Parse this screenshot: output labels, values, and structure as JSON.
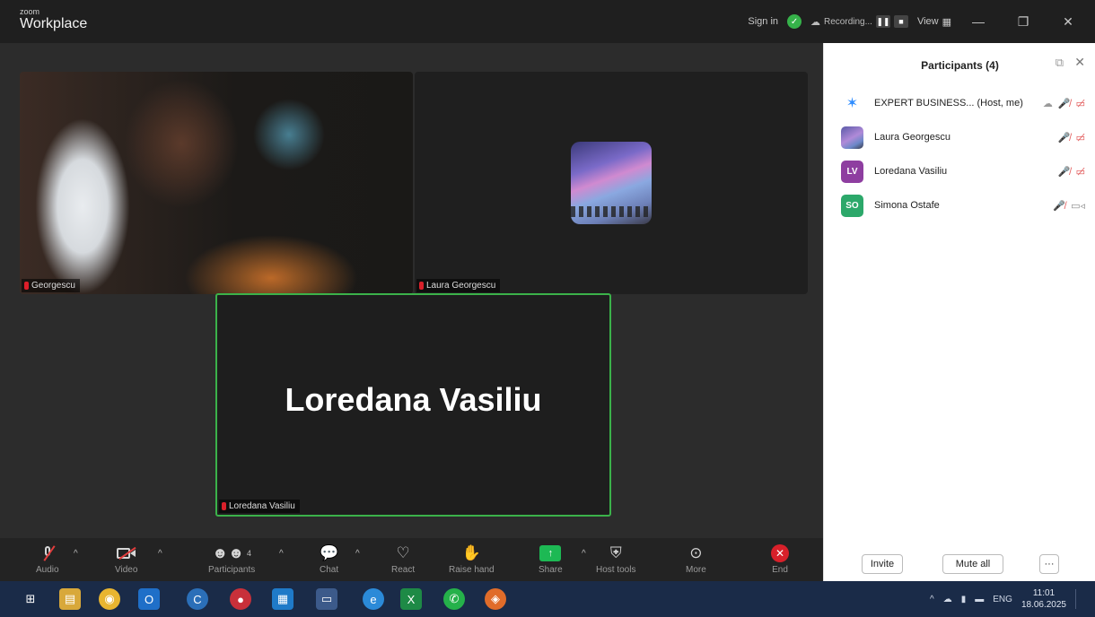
{
  "titlebar": {
    "brand_small": "zoom",
    "brand_big": "Workplace",
    "sign_in": "Sign in",
    "recording": "Recording...",
    "view": "View",
    "minimize": "—",
    "restore": "❐",
    "close": "✕"
  },
  "tiles": {
    "a_name": "Georgescu",
    "b_name": "Laura Georgescu",
    "c_name": "Loredana Vasiliu",
    "c_big": "Loredana Vasiliu"
  },
  "toolbar": {
    "audio": "Audio",
    "video": "Video",
    "participants": "Participants",
    "participants_count": "4",
    "chat": "Chat",
    "react": "React",
    "raise_hand": "Raise hand",
    "share": "Share",
    "host_tools": "Host tools",
    "more": "More",
    "end": "End"
  },
  "panel": {
    "title": "Participants (4)",
    "participants": [
      {
        "name": "EXPERT BUSINESS... (Host, me)",
        "initials": "",
        "cam_on": false
      },
      {
        "name": "Laura Georgescu",
        "initials": "",
        "cam_on": false
      },
      {
        "name": "Loredana Vasiliu",
        "initials": "LV",
        "cam_on": false
      },
      {
        "name": "Simona Ostafe",
        "initials": "SO",
        "cam_on": true
      }
    ],
    "invite": "Invite",
    "mute_all": "Mute all",
    "more": "···"
  },
  "taskbar": {
    "lang": "ENG",
    "time": "11:01",
    "date": "18.06.2025"
  },
  "colors": {
    "active_speaker_border": "#3bb24a",
    "end_red": "#d8202a",
    "share_green": "#1db954",
    "lv_avatar": "#8e3ea0",
    "so_avatar": "#2ca86a"
  }
}
